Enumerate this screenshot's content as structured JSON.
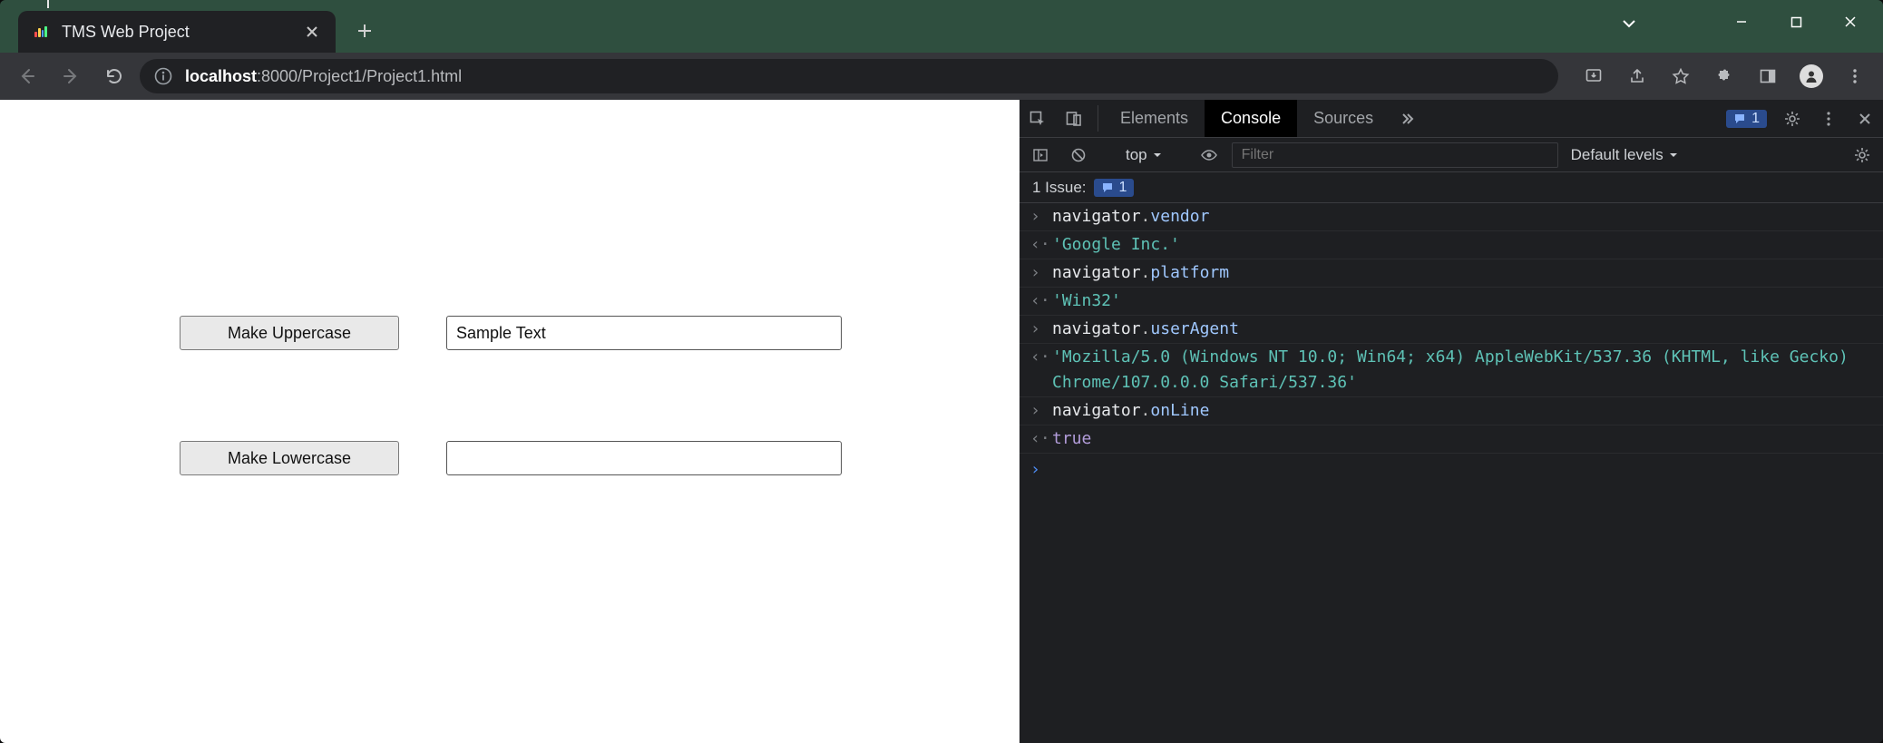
{
  "window": {
    "tab_title": "TMS Web Project"
  },
  "url": {
    "host": "localhost",
    "port_path": ":8000/Project1/Project1.html"
  },
  "page": {
    "btn_upper": "Make Uppercase",
    "btn_lower": "Make Lowercase",
    "input1": "Sample Text",
    "input2": ""
  },
  "devtools": {
    "tabs": {
      "elements": "Elements",
      "console": "Console",
      "sources": "Sources"
    },
    "issues_chip": "1",
    "context": "top",
    "filter_placeholder": "Filter",
    "levels": "Default levels",
    "issue_label": "1 Issue:",
    "issue_count": "1",
    "log": {
      "cmd1_obj": "navigator",
      "cmd1_prop": "vendor",
      "res1": "'Google Inc.'",
      "cmd2_obj": "navigator",
      "cmd2_prop": "platform",
      "res2": "'Win32'",
      "cmd3_obj": "navigator",
      "cmd3_prop": "userAgent",
      "res3": "'Mozilla/5.0 (Windows NT 10.0; Win64; x64) AppleWebKit/537.36 (KHTML, like Gecko) Chrome/107.0.0.0 Safari/537.36'",
      "cmd4_obj": "navigator",
      "cmd4_prop": "onLine",
      "res4": "true"
    }
  }
}
